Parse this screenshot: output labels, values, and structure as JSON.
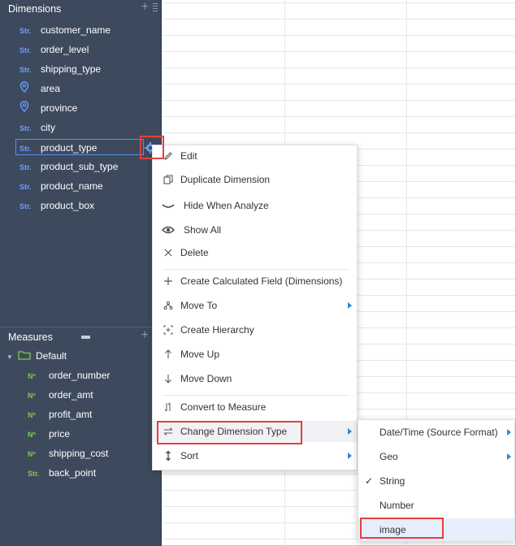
{
  "dimensions": {
    "title": "Dimensions",
    "items": [
      {
        "tag": "Str.",
        "name": "customer_name"
      },
      {
        "tag": "Str.",
        "name": "order_level"
      },
      {
        "tag": "Str.",
        "name": "shipping_type"
      },
      {
        "tag": "geo",
        "name": "area"
      },
      {
        "tag": "geo",
        "name": "province"
      },
      {
        "tag": "Str.",
        "name": "city"
      },
      {
        "tag": "Str.",
        "name": "product_type"
      },
      {
        "tag": "Str.",
        "name": "product_sub_type"
      },
      {
        "tag": "Str.",
        "name": "product_name"
      },
      {
        "tag": "Str.",
        "name": "product_box"
      }
    ]
  },
  "measures": {
    "title": "Measures",
    "group": "Default",
    "items": [
      {
        "tag": "Nº",
        "name": "order_number"
      },
      {
        "tag": "Nº",
        "name": "order_amt"
      },
      {
        "tag": "Nº",
        "name": "profit_amt"
      },
      {
        "tag": "Nº",
        "name": "price"
      },
      {
        "tag": "Nº",
        "name": "shipping_cost"
      },
      {
        "tag": "Str.",
        "name": "back_point"
      }
    ]
  },
  "context_menu": {
    "items": [
      {
        "label": "Edit",
        "icon": "pencil-icon"
      },
      {
        "label": "Duplicate Dimension",
        "icon": "copy-icon"
      },
      {
        "label": "Hide When Analyze",
        "icon": "eye-closed-icon"
      },
      {
        "label": "Show All",
        "icon": "eye-icon"
      },
      {
        "label": "Delete",
        "icon": "close-icon"
      },
      {
        "label": "Create Calculated Field (Dimensions)",
        "icon": "plus-icon"
      },
      {
        "label": "Move To",
        "icon": "move-to-icon"
      },
      {
        "label": "Create Hierarchy",
        "icon": "hierarchy-icon"
      },
      {
        "label": "Move Up",
        "icon": "arrow-up-icon"
      },
      {
        "label": "Move Down",
        "icon": "arrow-down-icon"
      },
      {
        "label": "Convert to Measure",
        "icon": "convert-icon"
      },
      {
        "label": "Change Dimension Type",
        "icon": "swap-icon"
      },
      {
        "label": "Sort",
        "icon": "sort-icon"
      }
    ]
  },
  "submenu": {
    "items": [
      {
        "label": "Date/Time (Source Format)"
      },
      {
        "label": "Geo"
      },
      {
        "label": "String",
        "checked": true
      },
      {
        "label": "Number"
      },
      {
        "label": "image"
      }
    ]
  },
  "colors": {
    "panel_bg": "#3d4a5d",
    "str_tag": "#6c9dff",
    "num_tag": "#7ccc4c",
    "highlight_red": "#e53e3e",
    "accent_arrow": "#2f86d6"
  }
}
